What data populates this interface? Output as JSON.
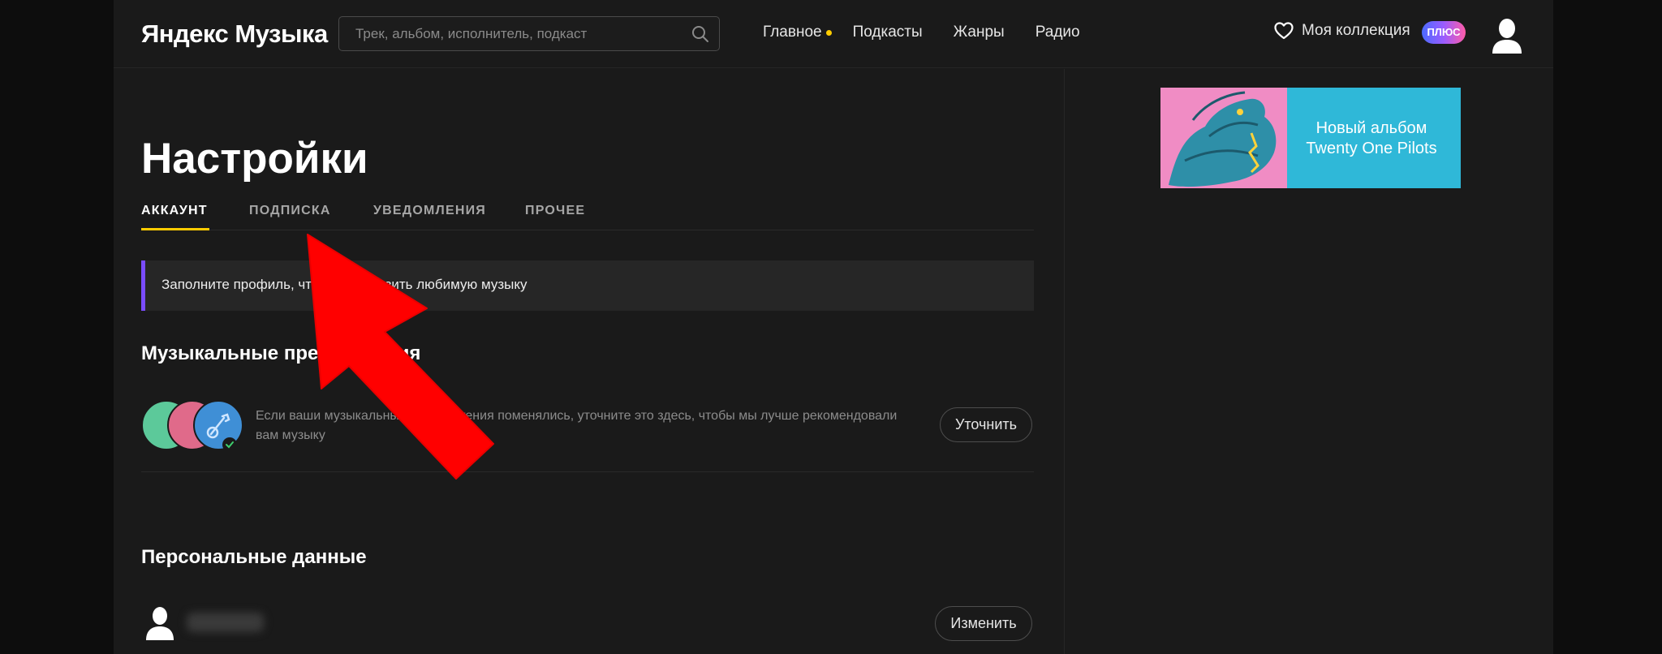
{
  "app": {
    "logo": "Яндекс Музыка"
  },
  "search": {
    "placeholder": "Трек, альбом, исполнитель, подкаст"
  },
  "nav": {
    "items": [
      {
        "label": "Главное"
      },
      {
        "label": "Подкасты"
      },
      {
        "label": "Жанры"
      },
      {
        "label": "Радио"
      }
    ],
    "collection_label": "Моя коллекция",
    "plus_badge": "ПЛЮС"
  },
  "page": {
    "title": "Настройки"
  },
  "tabs": [
    {
      "label": "АККАУНТ",
      "active": true
    },
    {
      "label": "ПОДПИСКА"
    },
    {
      "label": "УВЕДОМЛЕНИЯ"
    },
    {
      "label": "ПРОЧЕЕ"
    }
  ],
  "notice": {
    "text": "Заполните профиль, чтобы отобразить любимую музыку"
  },
  "music_prefs": {
    "title": "Музыкальные предпочтения",
    "description": "Если ваши музыкальные предпочтения поменялись, уточните это здесь, чтобы мы лучше рекомендовали вам музыку",
    "button": "Уточнить"
  },
  "personal": {
    "title": "Персональные данные",
    "button": "Изменить"
  },
  "banner": {
    "line1": "Новый альбом",
    "line2": "Twenty One Pilots"
  },
  "colors": {
    "accent": "#ffcc00",
    "notice_border": "#7a4cff",
    "annotation_arrow": "#ff0000",
    "banner_bg": "#2fb8d8"
  }
}
